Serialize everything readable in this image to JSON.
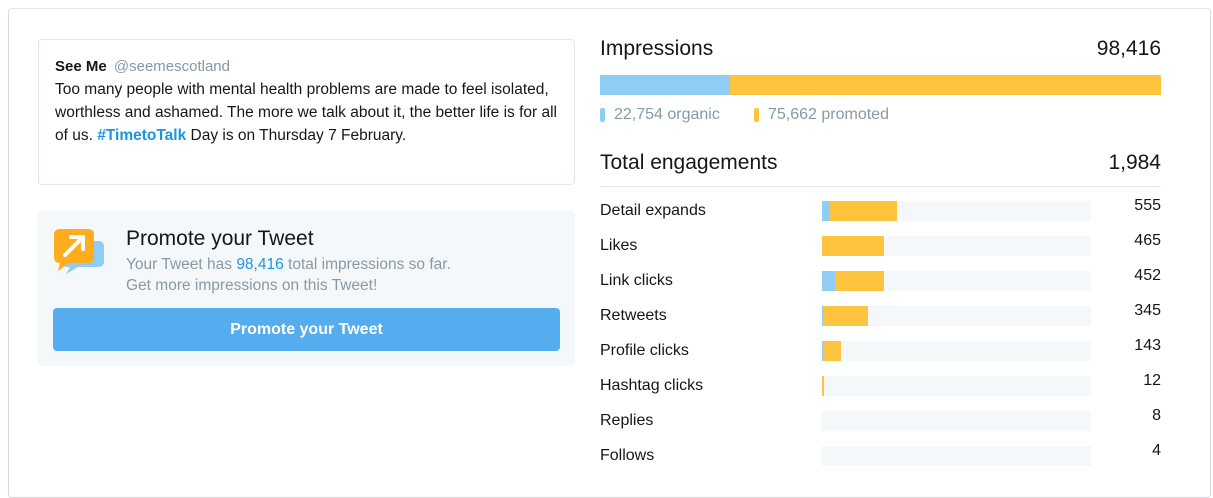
{
  "tweet": {
    "name": "See Me",
    "handle": "@seemescotland",
    "text_before": "Too many people with mental health problems are made to feel isolated, worthless and ashamed. The more we talk about it, the better life is for all of us. ",
    "hashtag": "#TimetoTalk",
    "text_after": " Day is on Thursday 7 February."
  },
  "promote": {
    "title": "Promote your Tweet",
    "line1_before": "Your Tweet has ",
    "line1_number": "98,416",
    "line1_after": " total impressions so far.",
    "line2": "Get more impressions on this Tweet!",
    "button_label": "Promote your Tweet"
  },
  "impressions": {
    "label": "Impressions",
    "value": "98,416",
    "organic_label": "22,754 organic",
    "promoted_label": "75,662 promoted",
    "organic_fraction": 0.2312,
    "promoted_fraction": 0.7688
  },
  "engagements": {
    "label": "Total engagements",
    "value": "1,984",
    "max": 1125,
    "rows": [
      {
        "label": "Detail expands",
        "value": "555",
        "organic": 33,
        "promoted": 282
      },
      {
        "label": "Likes",
        "value": "465",
        "organic": 2,
        "promoted": 259
      },
      {
        "label": "Link clicks",
        "value": "452",
        "organic": 55,
        "promoted": 206
      },
      {
        "label": "Retweets",
        "value": "345",
        "organic": 6,
        "promoted": 187
      },
      {
        "label": "Profile clicks",
        "value": "143",
        "organic": 6,
        "promoted": 75
      },
      {
        "label": "Hashtag clicks",
        "value": "12",
        "organic": 0,
        "promoted": 10
      },
      {
        "label": "Replies",
        "value": "8",
        "organic": 0,
        "promoted": 0
      },
      {
        "label": "Follows",
        "value": "4",
        "organic": 0,
        "promoted": 0
      }
    ]
  },
  "colors": {
    "organic": "#8fcdf5",
    "promoted": "#ffc43e",
    "link": "#1b95e0",
    "button": "#55acee"
  },
  "icons": {
    "promote": "promote-arrow-icon"
  }
}
